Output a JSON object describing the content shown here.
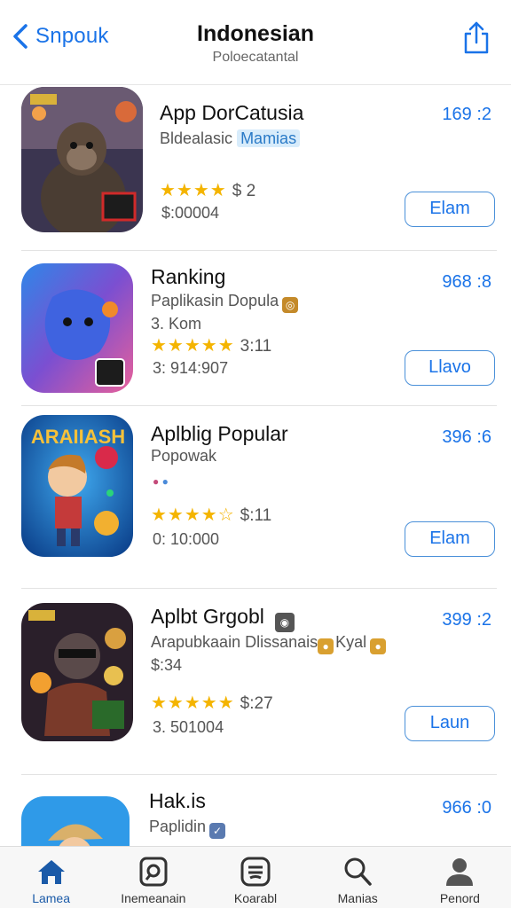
{
  "header": {
    "back_label": "Snpouk",
    "title": "Indonesian",
    "subtitle": "Poloecatantal"
  },
  "apps": [
    {
      "name": "App DorCatusia",
      "subtitle": "Bldealasic",
      "tag": "Mamias",
      "rating": "★★★★",
      "price": "$ 2",
      "meta": "$:00004",
      "size": "169 :2",
      "button": "Elam"
    },
    {
      "name": "Ranking",
      "subtitle": "Paplikasin Dopula",
      "extra": "3. Kom",
      "rating": "★★★★★",
      "price": "3:11",
      "meta": "3: 914:907",
      "size": "968 :8",
      "button": "Llavo"
    },
    {
      "name": "Aplblig Popular",
      "subtitle": "Popowak",
      "rating": "★★★★☆",
      "price": "$:11",
      "meta": "0: 10:000",
      "size": "396 :6",
      "button": "Elam",
      "thumb_title": "ARAIIASH"
    },
    {
      "name": "Aplbt Grgobl",
      "subtitle": "Arapubkaain Dlissanais",
      "subtitle2": "Kyal",
      "extra": "$:34",
      "rating": "★★★★★",
      "price": "$:27",
      "meta": "3. 501004",
      "size": "399 :2",
      "button": "Laun"
    },
    {
      "name": "Hak.is",
      "subtitle": "Paplidin",
      "size": "966 :0"
    }
  ],
  "tabs": [
    {
      "label": "Lamea",
      "icon": "home-icon",
      "active": true
    },
    {
      "label": "Inemeanain",
      "icon": "browse-icon"
    },
    {
      "label": "Koarabl",
      "icon": "games-icon"
    },
    {
      "label": "Manias",
      "icon": "search-icon"
    },
    {
      "label": "Penord",
      "icon": "profile-icon"
    }
  ],
  "colors": {
    "accent": "#1a73e8",
    "star": "#f4b400",
    "tab_active": "#1a5aa8"
  }
}
